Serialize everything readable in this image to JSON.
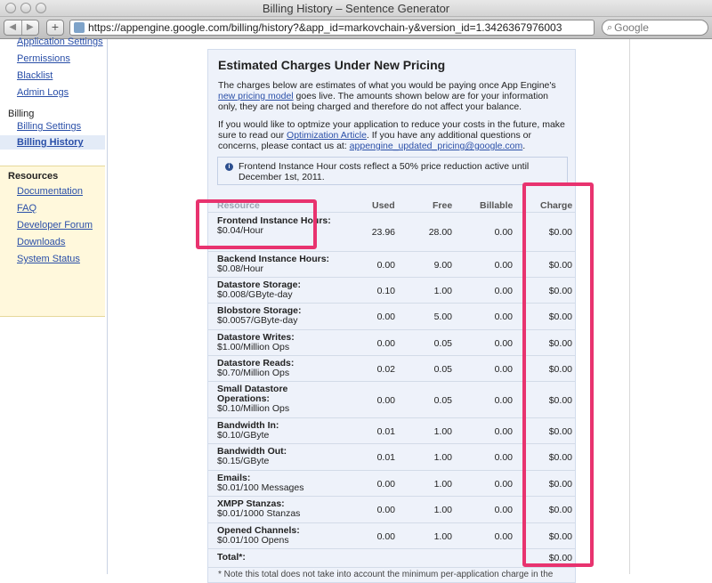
{
  "window": {
    "title": "Billing History – Sentence Generator"
  },
  "toolbar": {
    "back_glyph": "◀",
    "forward_glyph": "▶",
    "add_glyph": "+",
    "url": "https://appengine.google.com/billing/history?&app_id=markovchain-y&version_id=1.3426367976003",
    "search_placeholder": "Google",
    "search_glyph": "⌕"
  },
  "sidebar": {
    "top_items": [
      "Application Settings",
      "Permissions",
      "Blacklist",
      "Admin Logs"
    ],
    "billing_header": "Billing",
    "billing_items": [
      "Billing Settings",
      "Billing History"
    ],
    "resources_header": "Resources",
    "resource_items": [
      "Documentation",
      "FAQ",
      "Developer Forum",
      "Downloads",
      "System Status"
    ]
  },
  "main": {
    "title": "Estimated Charges Under New Pricing",
    "para1_a": "The charges below are estimates of what you would be paying once App Engine's ",
    "para1_link": "new pricing model",
    "para1_b": " goes live. The amounts shown below are for your information only, they are not being charged and therefore do not affect your balance.",
    "para2_a": "If you would like to optmize your application to reduce your costs in the future, make sure to read our ",
    "para2_link": "Optimization Article",
    "para2_b": ". If you have any additional questions or concerns, please contact us at: ",
    "para2_email": "appengine_updated_pricing@google.com",
    "para2_c": ".",
    "notice_icon": "i",
    "notice": "Frontend Instance Hour costs reflect a 50% price reduction active until December 1st, 2011.",
    "footnote": "* Note this total does not take into account the minimum per-application charge in the"
  },
  "table": {
    "headers": {
      "resource": "Resource",
      "used": "Used",
      "free": "Free",
      "billable": "Billable",
      "charge": "Charge"
    },
    "rows": [
      {
        "name": "Frontend Instance Hours:",
        "rate": "$0.04/Hour",
        "used": "23.96",
        "free": "28.00",
        "billable": "0.00",
        "charge": "$0.00"
      },
      {
        "name": "Backend Instance Hours:",
        "rate": "$0.08/Hour",
        "used": "0.00",
        "free": "9.00",
        "billable": "0.00",
        "charge": "$0.00"
      },
      {
        "name": "Datastore Storage:",
        "rate": "$0.008/GByte-day",
        "used": "0.10",
        "free": "1.00",
        "billable": "0.00",
        "charge": "$0.00"
      },
      {
        "name": "Blobstore Storage:",
        "rate": "$0.0057/GByte-day",
        "used": "0.00",
        "free": "5.00",
        "billable": "0.00",
        "charge": "$0.00"
      },
      {
        "name": "Datastore Writes:",
        "rate": "$1.00/Million Ops",
        "used": "0.00",
        "free": "0.05",
        "billable": "0.00",
        "charge": "$0.00"
      },
      {
        "name": "Datastore Reads:",
        "rate": "$0.70/Million Ops",
        "used": "0.02",
        "free": "0.05",
        "billable": "0.00",
        "charge": "$0.00"
      },
      {
        "name": "Small Datastore Operations:",
        "rate": "$0.10/Million Ops",
        "used": "0.00",
        "free": "0.05",
        "billable": "0.00",
        "charge": "$0.00"
      },
      {
        "name": "Bandwidth In:",
        "rate": "$0.10/GByte",
        "used": "0.01",
        "free": "1.00",
        "billable": "0.00",
        "charge": "$0.00"
      },
      {
        "name": "Bandwidth Out:",
        "rate": "$0.15/GByte",
        "used": "0.01",
        "free": "1.00",
        "billable": "0.00",
        "charge": "$0.00"
      },
      {
        "name": "Emails:",
        "rate": "$0.01/100 Messages",
        "used": "0.00",
        "free": "1.00",
        "billable": "0.00",
        "charge": "$0.00"
      },
      {
        "name": "XMPP Stanzas:",
        "rate": "$0.01/1000 Stanzas",
        "used": "0.00",
        "free": "1.00",
        "billable": "0.00",
        "charge": "$0.00"
      },
      {
        "name": "Opened Channels:",
        "rate": "$0.01/100 Opens",
        "used": "0.00",
        "free": "1.00",
        "billable": "0.00",
        "charge": "$0.00"
      }
    ],
    "total": {
      "name": "Total*:",
      "charge": "$0.00"
    }
  },
  "colors": {
    "highlight": "#e8336f",
    "link": "#2a4fa8",
    "panel_bg": "#eef2fa",
    "resources_bg": "#fff8dc"
  }
}
